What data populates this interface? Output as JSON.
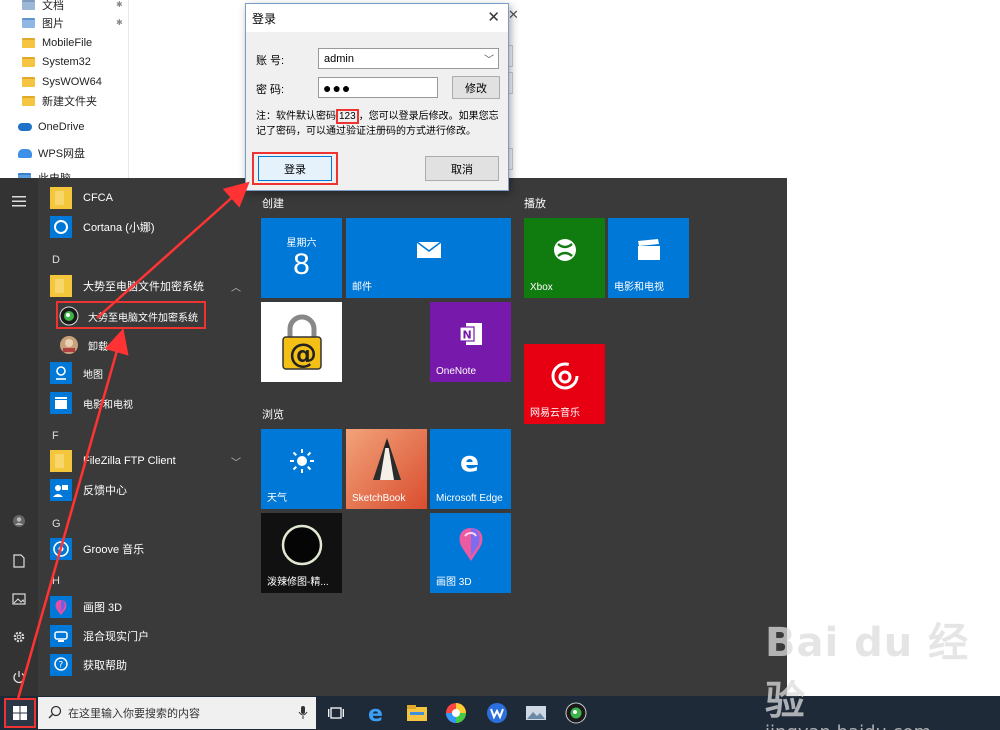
{
  "explorer": {
    "items": [
      {
        "label": "文档",
        "icon": "document-icon"
      },
      {
        "label": "图片",
        "icon": "picture-icon"
      },
      {
        "label": "MobileFile",
        "icon": "folder-icon"
      },
      {
        "label": "System32",
        "icon": "folder-icon"
      },
      {
        "label": "SysWOW64",
        "icon": "folder-icon"
      },
      {
        "label": "新建文件夹",
        "icon": "folder-icon"
      },
      {
        "label": "OneDrive",
        "icon": "onedrive-icon"
      },
      {
        "label": "WPS网盘",
        "icon": "wps-cloud-icon"
      },
      {
        "label": "此电脑",
        "icon": "computer-icon"
      }
    ]
  },
  "dialog": {
    "title": "登录",
    "account_label": "账  号:",
    "account_value": "admin",
    "password_label": "密  码:",
    "password_value": "●●●",
    "modify_button": "修改",
    "note_prefix": "注：软件默认密码",
    "note_code": "123",
    "note_suffix": "，您可以登录后修改。如果您忘记了密码，可以通过验证注册码的方式进行修改。",
    "login_button": "登录",
    "cancel_button": "取消"
  },
  "applist": {
    "items": [
      {
        "type": "app",
        "label": "CFCA",
        "icon": "folder-icon"
      },
      {
        "type": "app",
        "label": "Cortana (小娜)",
        "icon": "cortana-icon"
      },
      {
        "type": "letter",
        "label": "D"
      },
      {
        "type": "app",
        "label": "大势至电脑文件加密系统",
        "icon": "folder-icon",
        "chevron": "up"
      },
      {
        "type": "app",
        "label": "大势至电脑文件加密系统",
        "icon": "encrypt-app-icon",
        "selected": true
      },
      {
        "type": "app",
        "label": "卸载",
        "icon": "uninstall-icon"
      },
      {
        "type": "app",
        "label": "地图",
        "icon": "maps-icon"
      },
      {
        "type": "app",
        "label": "电影和电视",
        "icon": "movies-icon"
      },
      {
        "type": "letter",
        "label": "F"
      },
      {
        "type": "app",
        "label": "FileZilla FTP Client",
        "icon": "folder-icon",
        "chevron": "down"
      },
      {
        "type": "app",
        "label": "反馈中心",
        "icon": "feedback-icon"
      },
      {
        "type": "letter",
        "label": "G"
      },
      {
        "type": "app",
        "label": "Groove 音乐",
        "icon": "groove-icon"
      },
      {
        "type": "letter",
        "label": "H"
      },
      {
        "type": "app",
        "label": "画图 3D",
        "icon": "paint3d-icon"
      },
      {
        "type": "app",
        "label": "混合现实门户",
        "icon": "mixed-reality-icon"
      },
      {
        "type": "app",
        "label": "获取帮助",
        "icon": "help-icon"
      }
    ]
  },
  "groups": {
    "create": "创建",
    "browse": "浏览",
    "play": "播放"
  },
  "tiles": {
    "calendar_weekday": "星期六",
    "calendar_day": "8",
    "mail": "邮件",
    "onenote": "OneNote",
    "xbox": "Xbox",
    "movies": "电影和电视",
    "netease": "网易云音乐",
    "weather": "天气",
    "sketchbook": "SketchBook",
    "edge": "Microsoft Edge",
    "xuanlan": "泼辣修图-精...",
    "paint3d": "画图 3D"
  },
  "taskbar": {
    "search_placeholder": "在这里输入你要搜索的内容",
    "icons": [
      "task-view-icon",
      "edge-icon",
      "file-explorer-icon",
      "color-picker-icon",
      "wps-icon",
      "photos-icon",
      "encrypt-app-icon"
    ]
  },
  "watermark": {
    "brand": "Bai du 经验",
    "url": "jingyan.baidu.com"
  },
  "colors": {
    "accent_blue": "#0078d7",
    "highlight_red": "#e33333",
    "start_bg": "#3a3a3a",
    "xbox_green": "#107c10",
    "onenote_purple": "#7719aa",
    "netease_red": "#e60012"
  }
}
